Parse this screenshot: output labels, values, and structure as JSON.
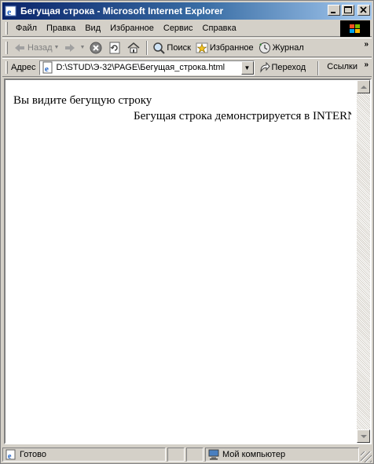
{
  "window": {
    "title": "Бегущая строка - Microsoft Internet Explorer"
  },
  "menu": {
    "items": [
      "Файл",
      "Правка",
      "Вид",
      "Избранное",
      "Сервис",
      "Справка"
    ]
  },
  "toolbar": {
    "back_label": "Назад",
    "search_label": "Поиск",
    "favorites_label": "Избранное",
    "history_label": "Журнал"
  },
  "address": {
    "label": "Адрес",
    "value": "D:\\STUD\\Э-32\\PAGE\\Бегущая_строка.html",
    "go_label": "Переход",
    "links_label": "Ссылки"
  },
  "page": {
    "line1": "Вы видите бегущую строку",
    "marquee": "Бегущая строка демонстрируется в INTERNET"
  },
  "status": {
    "text": "Готово",
    "zone": "Мой компьютер"
  },
  "colors": {
    "titlebar_start": "#0a246a",
    "titlebar_end": "#a6caf0",
    "chrome": "#d4d0c8"
  }
}
